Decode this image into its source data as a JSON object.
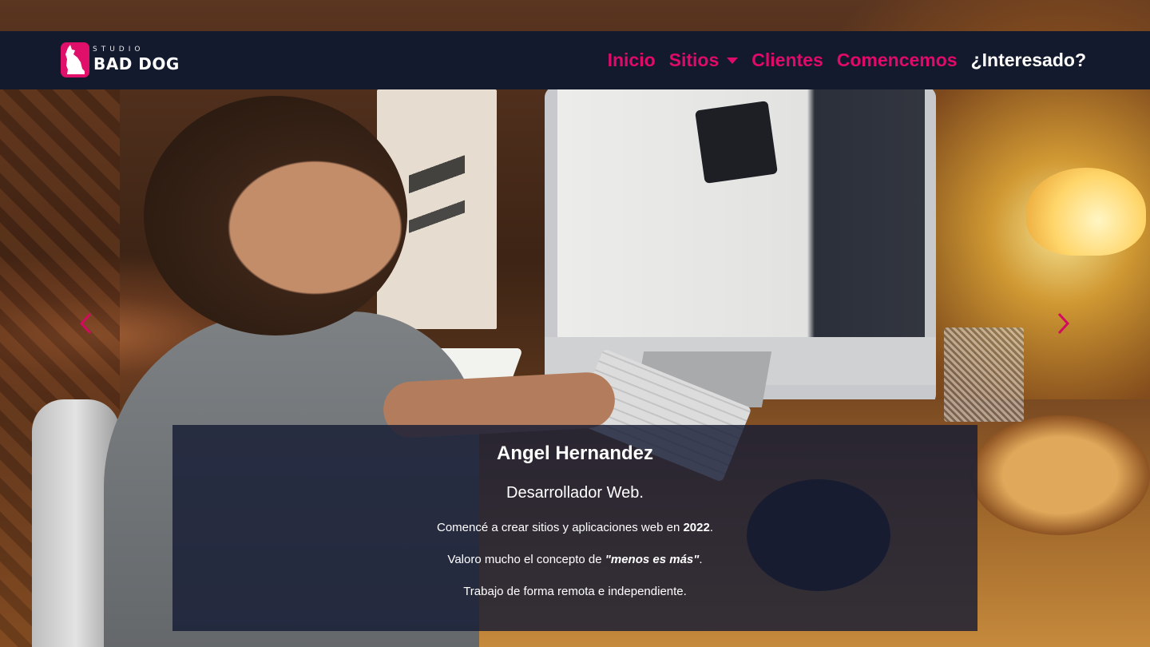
{
  "brand": {
    "small_text": "STUDIO",
    "name": "BAD DOG",
    "accent_color": "#e0106a",
    "logo_icon": "dog-icon"
  },
  "nav": {
    "items": [
      {
        "label": "Inicio"
      },
      {
        "label": "Sitios",
        "has_dropdown": true
      },
      {
        "label": "Clientes"
      },
      {
        "label": "Comencemos"
      },
      {
        "label": "¿Interesado?"
      }
    ]
  },
  "carousel": {
    "prev_icon": "chevron-left-icon",
    "next_icon": "chevron-right-icon"
  },
  "caption": {
    "name": "Angel Hernandez",
    "role": "Desarrollador Web.",
    "line1_prefix": "Comencé a crear sitios y aplicaciones web en ",
    "line1_year": "2022",
    "line1_suffix": ".",
    "line2_prefix": "Valoro mucho el concepto de ",
    "line2_quote": "\"menos es más\"",
    "line2_suffix": ".",
    "line3": "Trabajo de forma remota e independiente."
  },
  "colors": {
    "navbar_bg": "#141a2e",
    "nav_link": "#df0a6a",
    "caption_bg": "rgba(22,28,52,0.82)"
  }
}
